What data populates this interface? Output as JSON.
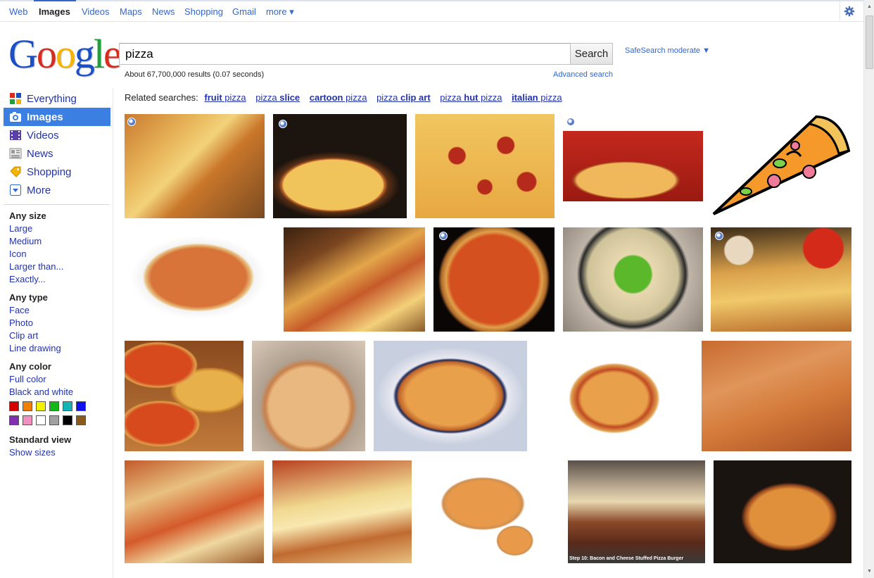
{
  "topnav": {
    "items": [
      {
        "label": "Web"
      },
      {
        "label": "Images"
      },
      {
        "label": "Videos"
      },
      {
        "label": "Maps"
      },
      {
        "label": "News"
      },
      {
        "label": "Shopping"
      },
      {
        "label": "Gmail"
      },
      {
        "label": "more ▾"
      }
    ],
    "active": "Images",
    "settings_icon": "gear-icon"
  },
  "logo": {
    "text": "Google",
    "letter_colors": [
      "#1a4fc7",
      "#d62d20",
      "#f4b400",
      "#1a4fc7",
      "#1f9e3b",
      "#d62d20"
    ]
  },
  "search": {
    "query": "pizza",
    "button_label": "Search",
    "safesearch": "SafeSearch moderate ▼",
    "result_stats": "About 67,700,000 results (0.07 seconds)",
    "advanced_link": "Advanced search"
  },
  "leftnav": {
    "items": [
      {
        "label": "Everything",
        "icon": "everything-icon"
      },
      {
        "label": "Images",
        "icon": "camera-icon"
      },
      {
        "label": "Videos",
        "icon": "film-icon"
      },
      {
        "label": "News",
        "icon": "newspaper-icon"
      },
      {
        "label": "Shopping",
        "icon": "tag-icon"
      },
      {
        "label": "More",
        "icon": "chevron-down-icon"
      }
    ],
    "active": "Images"
  },
  "filters": {
    "size": {
      "heading": "Any size",
      "options": [
        "Large",
        "Medium",
        "Icon",
        "Larger than...",
        "Exactly..."
      ]
    },
    "type": {
      "heading": "Any type",
      "options": [
        "Face",
        "Photo",
        "Clip art",
        "Line drawing"
      ]
    },
    "color": {
      "heading": "Any color",
      "options": [
        "Full color",
        "Black and white"
      ],
      "swatches": [
        "#d60000",
        "#ee7f00",
        "#f2f200",
        "#14b814",
        "#14b4b4",
        "#1010f0",
        "#8030b0",
        "#f090c0",
        "#ffffff",
        "#a0a0a0",
        "#000000",
        "#8a5a1a"
      ]
    },
    "view": {
      "heading": "Standard view",
      "option": "Show sizes"
    }
  },
  "related": {
    "label": "Related searches:",
    "links": [
      {
        "bold": "fruit",
        "plain": " pizza"
      },
      {
        "bold": "",
        "plain": "pizza ",
        "bold_after": "slice"
      },
      {
        "bold": "cartoon",
        "plain": " pizza"
      },
      {
        "bold": "",
        "plain": "pizza ",
        "bold_after": "clip art"
      },
      {
        "bold": "",
        "plain": "pizza ",
        "bold_after": "hut",
        "plain_after": " pizza"
      },
      {
        "bold": "italian",
        "plain": " pizza"
      }
    ]
  },
  "results": {
    "caption_16": "Step 10: Bacon and Cheese Stuffed Pizza Burger"
  }
}
